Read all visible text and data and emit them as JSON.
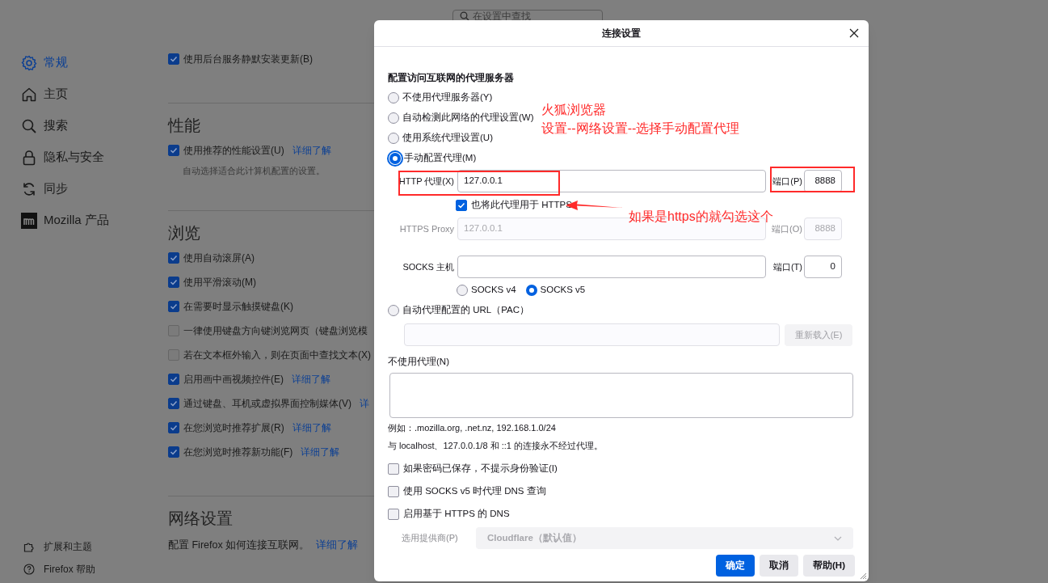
{
  "search": {
    "placeholder": "在设置中查找"
  },
  "sidebar": {
    "items": [
      {
        "label": "常规",
        "selected": true
      },
      {
        "label": "主页",
        "selected": false
      },
      {
        "label": "搜索",
        "selected": false
      },
      {
        "label": "隐私与安全",
        "selected": false
      },
      {
        "label": "同步",
        "selected": false
      },
      {
        "label": "Mozilla 产品",
        "selected": false
      }
    ],
    "footer": [
      "扩展和主题",
      "Firefox 帮助"
    ]
  },
  "sections": [
    {
      "items": [
        {
          "kind": "checkbox",
          "label": "使用后台服务静默安装更新(B)",
          "checked": true
        }
      ]
    },
    {
      "heading": "性能",
      "items": [
        {
          "kind": "checkbox",
          "label": "使用推荐的性能设置(U)",
          "checked": true,
          "link": "详细了解"
        },
        {
          "kind": "note",
          "text": "自动选择适合此计算机配置的设置。"
        }
      ]
    },
    {
      "heading": "浏览",
      "items": [
        {
          "kind": "checkbox",
          "label": "使用自动滚屏(A)",
          "checked": true
        },
        {
          "kind": "checkbox",
          "label": "使用平滑滚动(M)",
          "checked": true
        },
        {
          "kind": "checkbox",
          "label": "在需要时显示触摸键盘(K)",
          "checked": true
        },
        {
          "kind": "checkbox",
          "label": "一律使用键盘方向键浏览网页（键盘浏览模",
          "checked": false
        },
        {
          "kind": "checkbox",
          "label": "若在文本框外输入，则在页面中查找文本(X)",
          "checked": false
        },
        {
          "kind": "checkbox",
          "label": "启用画中画视频控件(E)",
          "checked": true,
          "link": "详细了解"
        },
        {
          "kind": "checkbox",
          "label": "通过键盘、耳机或虚拟界面控制媒体(V)",
          "checked": true,
          "link": "详"
        },
        {
          "kind": "checkbox",
          "label": "在您浏览时推荐扩展(R)",
          "checked": true,
          "link": "详细了解"
        },
        {
          "kind": "checkbox",
          "label": "在您浏览时推荐新功能(F)",
          "checked": true,
          "link": "详细了解"
        }
      ]
    },
    {
      "heading": "网络设置",
      "items": [
        {
          "kind": "text",
          "text": "配置 Firefox 如何连接互联网。",
          "link": "详细了解"
        }
      ]
    }
  ],
  "dialog": {
    "title": "连接设置",
    "heading": "配置访问互联网的代理服务器",
    "modes": [
      {
        "label": "不使用代理服务器(Y)",
        "selected": false
      },
      {
        "label": "自动检测此网络的代理设置(W)",
        "selected": false
      },
      {
        "label": "使用系统代理设置(U)",
        "selected": false
      },
      {
        "label": "手动配置代理(M)",
        "selected": true
      }
    ],
    "http": {
      "label": "HTTP 代理(X)",
      "value": "127.0.0.1",
      "port_label": "端口(P)",
      "port": "8888"
    },
    "also_https": {
      "label": "也将此代理用于 HTTPS",
      "checked": true
    },
    "https": {
      "label": "HTTPS Proxy",
      "value": "127.0.0.1",
      "port_label": "端口(O)",
      "port": "8888",
      "disabled": true
    },
    "socks": {
      "label": "SOCKS 主机",
      "port_label": "端口(T)",
      "port": "0"
    },
    "socks_versions": [
      {
        "label": "SOCKS v4",
        "selected": false
      },
      {
        "label": "SOCKS v5",
        "selected": true
      }
    ],
    "pac": {
      "label": "自动代理配置的 URL（PAC）",
      "selected": false,
      "reload_button": "重新载入(E)"
    },
    "no_proxy": {
      "label": "不使用代理(N)",
      "hints": [
        "例如：.mozilla.org, .net.nz, 192.168.1.0/24",
        "与 localhost、127.0.0.1/8 和 ::1 的连接永不经过代理。"
      ]
    },
    "options": [
      {
        "label": "如果密码已保存，不提示身份验证(I)",
        "checked": false
      },
      {
        "label": "使用 SOCKS v5 时代理 DNS 查询",
        "checked": false
      },
      {
        "label": "启用基于 HTTPS 的 DNS",
        "checked": false
      }
    ],
    "provider": {
      "label": "选用提供商(P)",
      "value": "Cloudflare（默认值）",
      "disabled": true
    },
    "buttons": [
      {
        "label": "确定",
        "kind": "primary"
      },
      {
        "label": "取消",
        "kind": "secondary"
      },
      {
        "label": "帮助(H)",
        "kind": "secondary"
      }
    ]
  },
  "annotations": {
    "notes": [
      "火狐浏览器",
      "设置--网络设置--选择手动配置代理"
    ],
    "callout": "如果是https的就勾选这个"
  }
}
